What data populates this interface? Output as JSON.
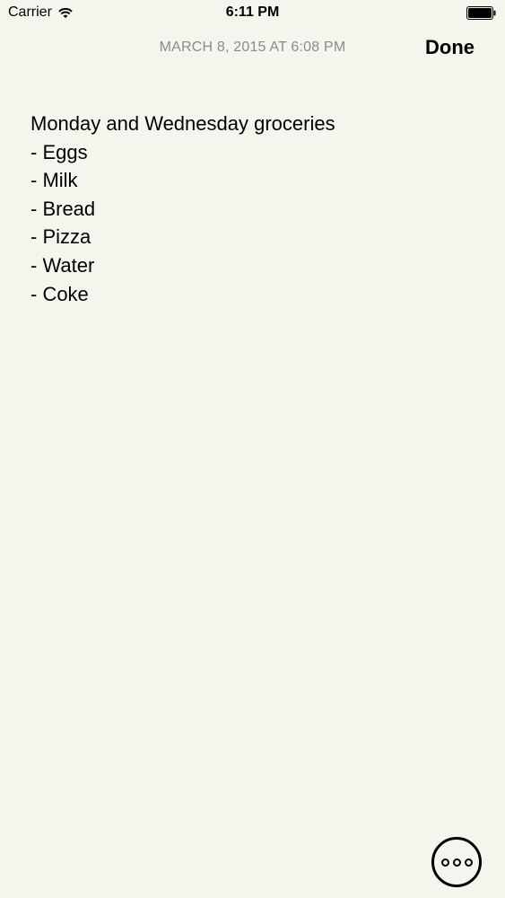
{
  "status_bar": {
    "carrier": "Carrier",
    "time": "6:11 PM"
  },
  "header": {
    "date": "MARCH 8, 2015 AT 6:08 PM",
    "done_label": "Done"
  },
  "note": {
    "lines": [
      "Monday and Wednesday groceries",
      "- Eggs",
      "- Milk",
      "- Bread",
      "- Pizza",
      "- Water",
      "- Coke"
    ]
  },
  "icons": {
    "wifi": "wifi-icon",
    "battery": "battery-icon",
    "more": "ellipsis-icon"
  },
  "colors": {
    "background": "#f5f4ed",
    "date_text": "#8b8b8b",
    "text": "#000000"
  }
}
